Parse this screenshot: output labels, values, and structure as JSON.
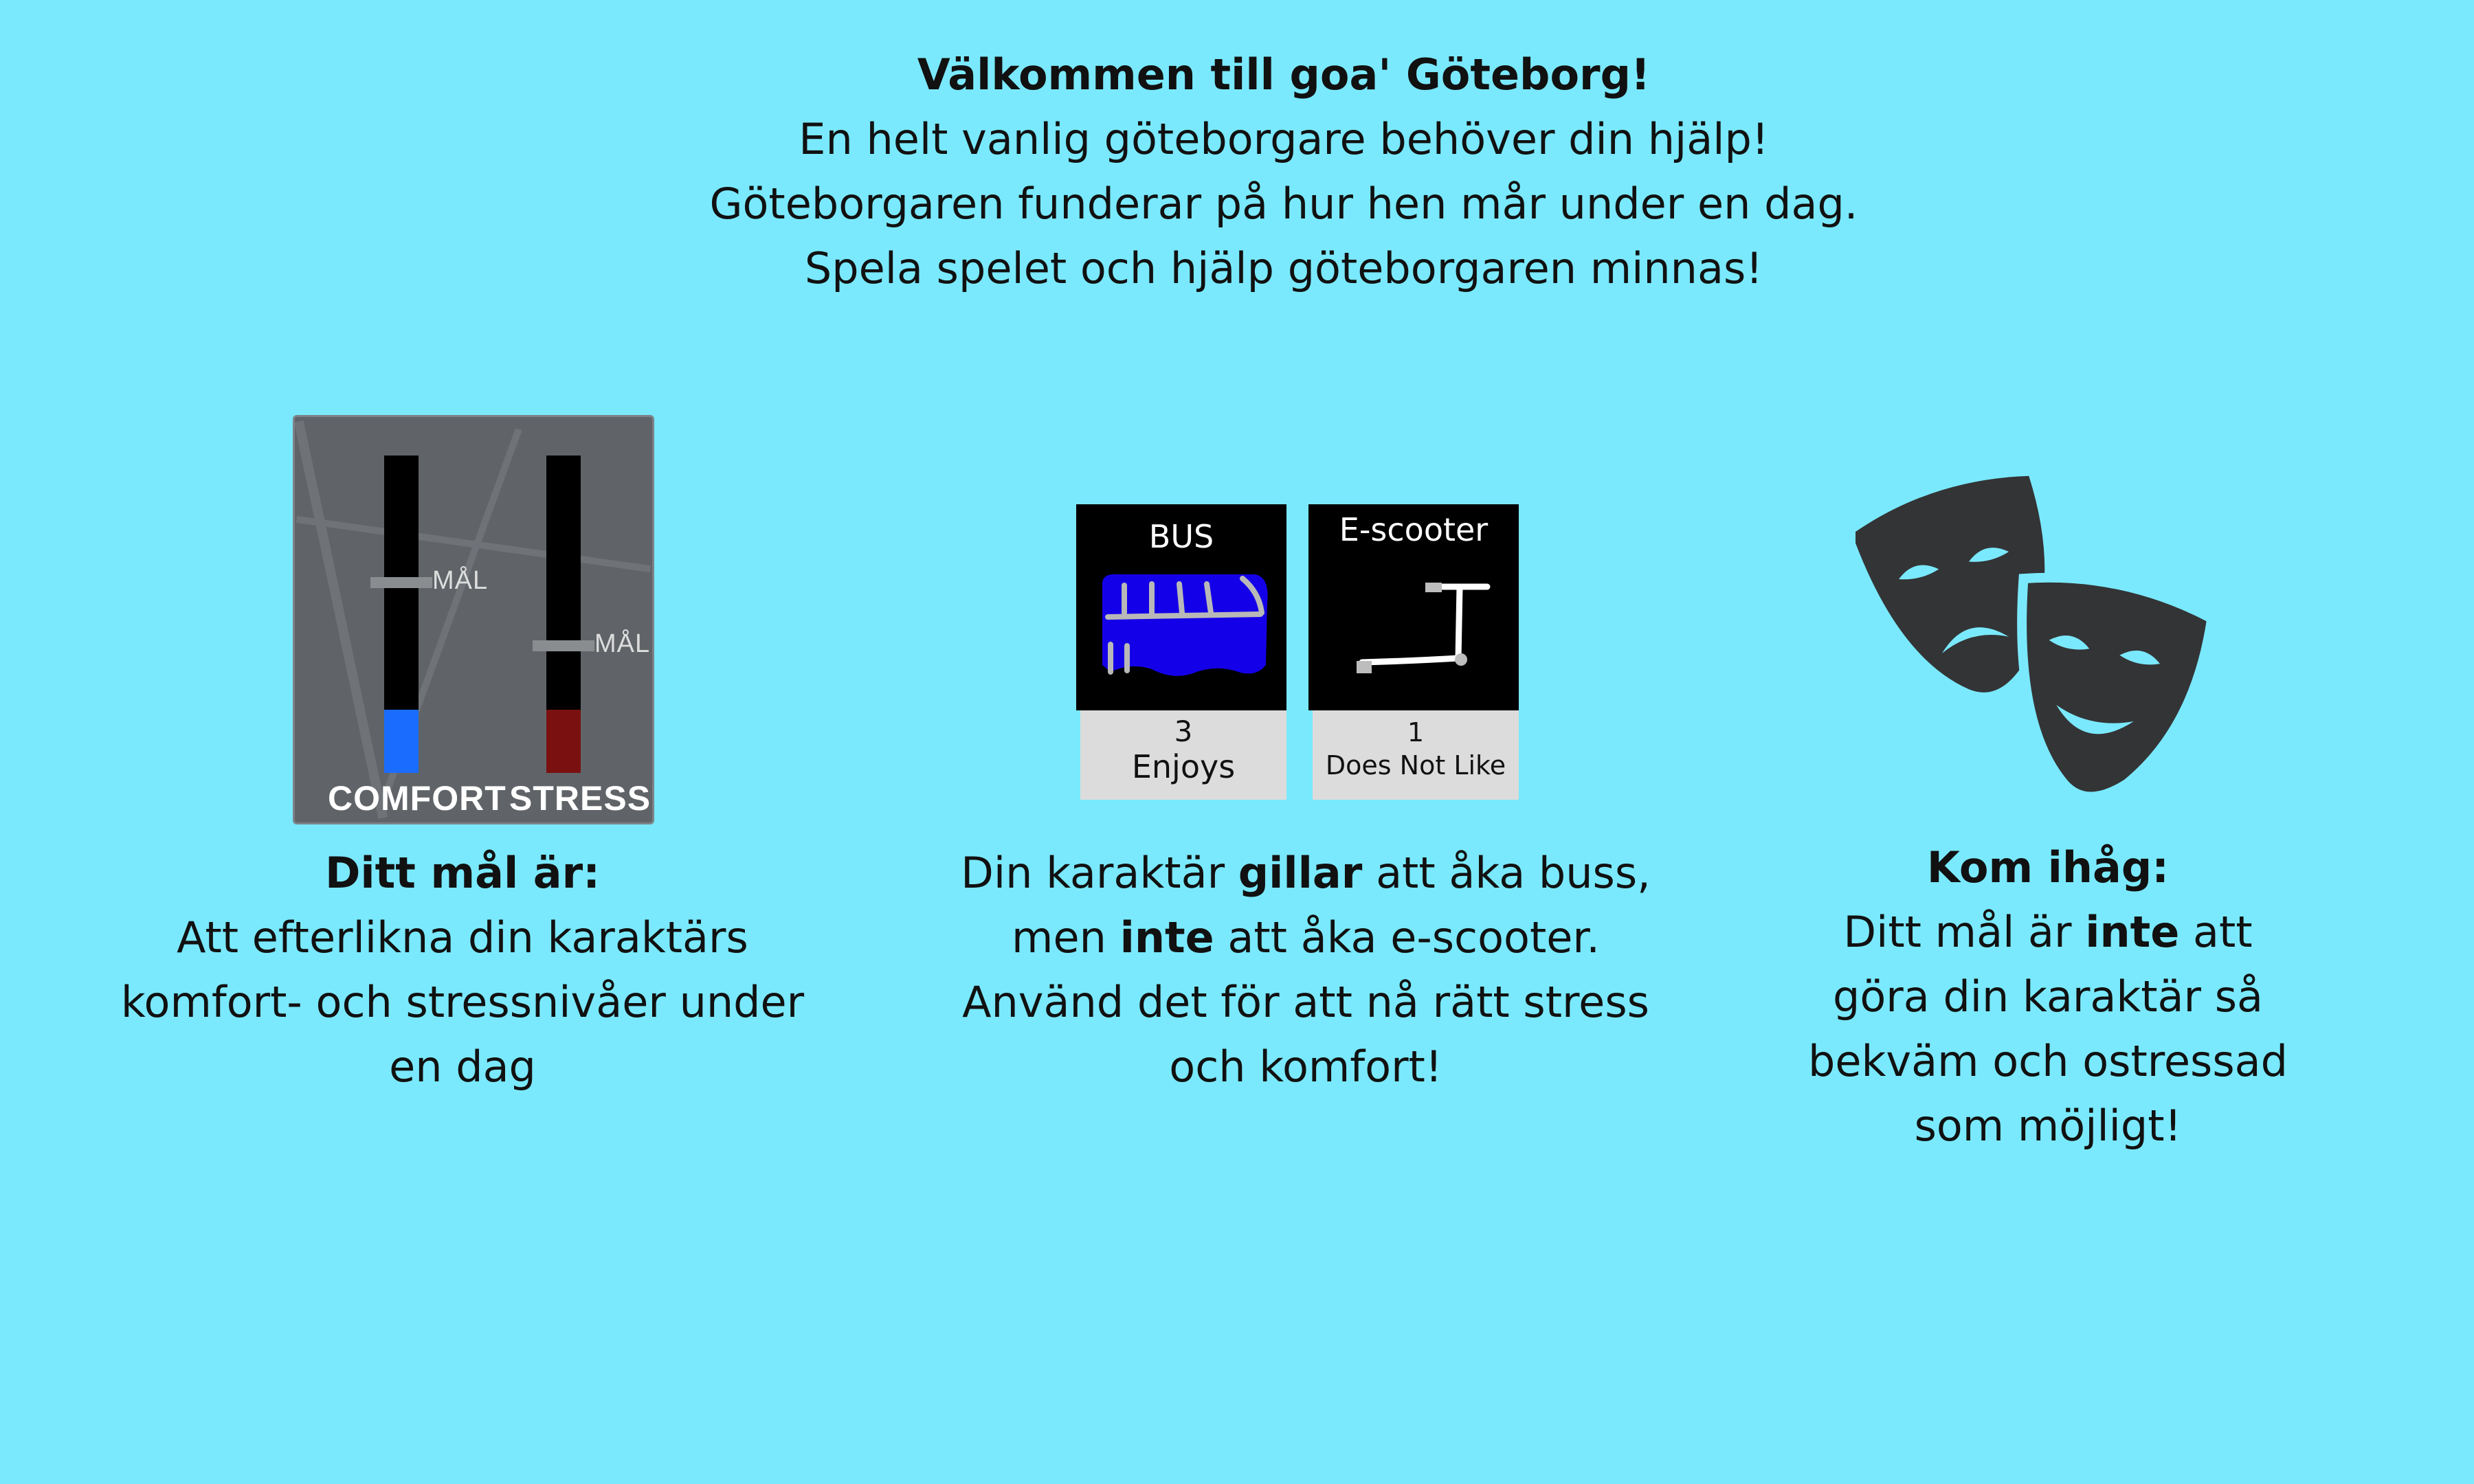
{
  "intro": {
    "title": "Välkommen till goa' Göteborg!",
    "line1": "En helt vanlig göteborgare behöver din hjälp!",
    "line2": "Göteborgaren funderar på hur hen mår under en dag.",
    "line3": "Spela spelet och hjälp göteborgaren minnas!"
  },
  "meters": {
    "comfort_label": "COMFORT",
    "stress_label": "STRESS",
    "goal_label": "MÅL",
    "comfort_level": 0.2,
    "stress_level": 0.2,
    "comfort_goal": 0.6,
    "stress_goal": 0.4
  },
  "goal_text": {
    "heading": "Ditt mål är:",
    "line1": "Att efterlikna din karaktärs",
    "line2": "komfort- och stressnivåer under",
    "line3": "en dag"
  },
  "cards": [
    {
      "name": "BUS",
      "count": "3",
      "verdict": "Enjoys"
    },
    {
      "name": "E-scooter",
      "count": "1",
      "verdict": "Does Not Like"
    }
  ],
  "preference_text": {
    "l1_pre": "Din karaktär ",
    "l1_bold": "gillar",
    "l1_post": " att åka buss,",
    "l2_pre": "men ",
    "l2_bold": "inte",
    "l2_post": " att åka e-scooter.",
    "line3": "Använd det för att nå rätt stress",
    "line4": "och komfort!"
  },
  "remember_text": {
    "heading": "Kom ihåg:",
    "l1_pre": "Ditt mål är ",
    "l1_bold": "inte",
    "l1_post": " att",
    "line2": "göra din karaktär så",
    "line3": "bekväm och ostressad",
    "line4": "som möjligt!"
  },
  "colors": {
    "background": "#7ae9fd",
    "comfort": "#1a6cff",
    "stress": "#7a1010",
    "bus": "#1400e8",
    "mask": "#333436"
  },
  "icons": [
    "theater-masks-icon",
    "bus-icon",
    "scooter-icon"
  ]
}
